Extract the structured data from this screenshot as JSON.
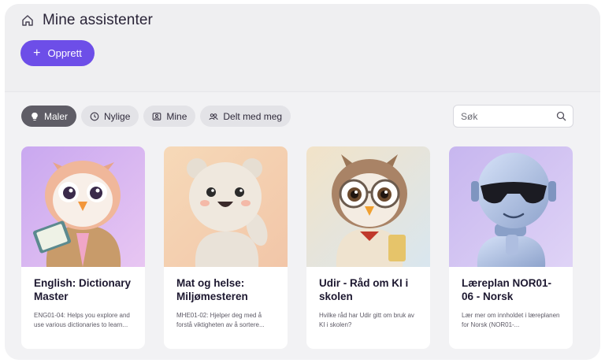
{
  "header": {
    "title": "Mine assistenter",
    "create_label": "Opprett"
  },
  "filters": [
    {
      "label": "Maler",
      "icon": "bulb-icon",
      "active": true
    },
    {
      "label": "Nylige",
      "icon": "clock-icon",
      "active": false
    },
    {
      "label": "Mine",
      "icon": "portrait-icon",
      "active": false
    },
    {
      "label": "Delt med meg",
      "icon": "people-icon",
      "active": false
    }
  ],
  "search": {
    "placeholder": "Søk",
    "value": ""
  },
  "cards": [
    {
      "title": "English: Dictionary Master",
      "description": "ENG01-04: Helps you explore and use various dictionaries to learn...",
      "image": "owl-mascot-with-book"
    },
    {
      "title": "Mat og helse: Miljømesteren",
      "description": "MHE01-02: Hjelper deg med å forstå viktigheten av å sortere...",
      "image": "white-bear-mascot-waving"
    },
    {
      "title": "Udir - Råd om KI i skolen",
      "description": "Hvilke råd har Udir gitt om bruk av KI i skolen?",
      "image": "owl-mascot-with-glasses"
    },
    {
      "title": "Læreplan NOR01-06 - Norsk",
      "description": "Lær mer om innholdet i læreplanen for Norsk (NOR01-...",
      "image": "robot-mascot-with-sunglasses"
    }
  ],
  "colors": {
    "accent": "#6d4ee8",
    "active_chip": "#5f5d66",
    "chip": "#e3e3e7",
    "background": "#f2f2f4"
  }
}
